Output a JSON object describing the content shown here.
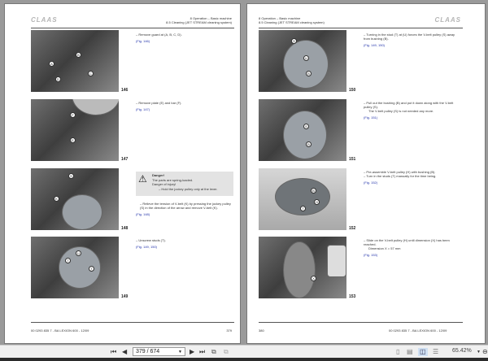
{
  "left_page": {
    "logo": "CLAAS",
    "header": [
      "8 Operation – Basic machine",
      "8.5 Cleaning (JET STREAM cleaning system)"
    ],
    "figures": [
      {
        "num": "146",
        "labels": [
          "A",
          "B",
          "C",
          "D"
        ],
        "text": [
          "– Remove guard at (A, B, C, D)."
        ],
        "ref": "(Fig. 146)"
      },
      {
        "num": "147",
        "labels": [
          "F",
          "E"
        ],
        "text": [
          "– Remove plate (E) and bar (F)."
        ],
        "ref": "(Fig. 147)"
      },
      {
        "num": "148",
        "labels": [
          "S",
          "K"
        ],
        "text": [
          "– Relieve the tension of V-belt (K) by pressing the jockey pulley (S) in the direction of the arrow and remove V-belt (K)."
        ],
        "ref": "(Fig. 148)"
      },
      {
        "num": "149",
        "labels": [
          "T",
          "U",
          "T"
        ],
        "text": [
          "– Unscrew studs (T)."
        ],
        "ref": "(Fig. 149, 150)"
      }
    ],
    "danger": {
      "title": "Danger!",
      "lines": [
        "The parts are spring-loaded.",
        "Danger of injury!",
        "– Hold the jockey pulley only at the lever."
      ]
    },
    "footer_doc": "00 0293 835 7 - BA LEXION 600 - 12/09",
    "page_no": "379"
  },
  "right_page": {
    "logo": "CLAAS",
    "header": [
      "8 Operation – Basic machine",
      "8.5 Cleaning (JET STREAM cleaning system)"
    ],
    "figures": [
      {
        "num": "150",
        "labels": [
          "S",
          "U",
          "B"
        ],
        "text": [
          "– Turning in the stud (T) at (U) forces the V-belt pulley (S) away from bushing (B)."
        ],
        "ref": "(Fig. 149, 150)"
      },
      {
        "num": "151",
        "labels": [
          "S",
          "B"
        ],
        "text": [
          "– Pull out the bushing (B) and put it down along with the V-belt pulley (S).",
          "The V-belt pulley (S) is not needed any more."
        ],
        "ref": "(Fig. 151)"
      },
      {
        "num": "152",
        "labels": [
          "B",
          "H",
          "T"
        ],
        "text": [
          "– Pre-assemble V-belt pulley (H) with bushing (B).",
          "– Turn in the studs (T) manually for the time being."
        ],
        "ref": "(Fig. 152)"
      },
      {
        "num": "153",
        "labels": [
          "X"
        ],
        "text": [
          "– Slide on the V-belt pulley (H) until dimension (X) has been reached.",
          "Dimension X = 57 mm"
        ],
        "ref": "(Fig. 153)"
      }
    ],
    "footer_doc": "00 0293 835 7 - BA LEXION 600 - 12/09",
    "page_no": "380"
  },
  "toolbar": {
    "page_value": "379 / 674",
    "zoom": "65.42%"
  }
}
